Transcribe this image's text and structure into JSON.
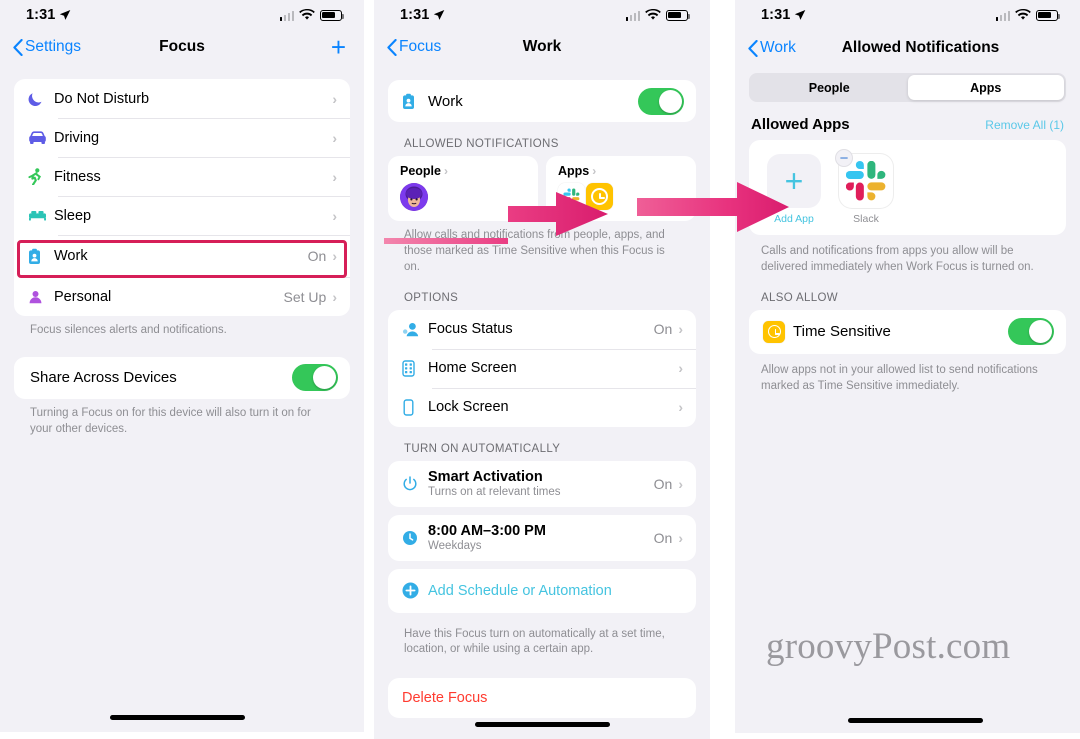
{
  "colors": {
    "accent_blue": "#0a84ff",
    "teal": "#45c4e0",
    "green_toggle": "#34c759",
    "highlight_pink": "#d61f58",
    "arrow_pink": "#e8337d",
    "destructive_red": "#ff3b30",
    "page_bg": "#f2f1f6"
  },
  "status_bar": {
    "time": "1:31",
    "location_icon": "location-arrow-icon",
    "wifi_icon": "wifi-icon",
    "battery_icon": "battery-icon",
    "cellular_icon": "cellular-bars-icon"
  },
  "panel1": {
    "nav": {
      "back_label": "Settings",
      "title": "Focus",
      "add_label": "+"
    },
    "focus_modes": [
      {
        "label": "Do Not Disturb",
        "icon": "moon-icon",
        "value": ""
      },
      {
        "label": "Driving",
        "icon": "car-icon",
        "value": ""
      },
      {
        "label": "Fitness",
        "icon": "runner-icon",
        "value": ""
      },
      {
        "label": "Sleep",
        "icon": "bed-icon",
        "value": ""
      },
      {
        "label": "Work",
        "icon": "badge-id-icon",
        "value": "On"
      },
      {
        "label": "Personal",
        "icon": "person-icon",
        "value": "Set Up"
      }
    ],
    "footnote": "Focus silences alerts and notifications.",
    "share": {
      "label": "Share Across Devices",
      "toggle_state": "on",
      "footnote": "Turning a Focus on for this device will also turn it on for your other devices."
    }
  },
  "panel2": {
    "nav": {
      "back_label": "Focus",
      "title": "Work"
    },
    "master": {
      "label": "Work",
      "icon": "badge-id-icon",
      "toggle_state": "on"
    },
    "allowed_section_header": "ALLOWED NOTIFICATIONS",
    "people_card": {
      "title": "People",
      "chevron": "›",
      "avatar": "person-avatar"
    },
    "apps_card": {
      "title": "Apps",
      "chevron": "›",
      "app_icons": [
        "slack-icon",
        "clock-icon"
      ]
    },
    "allowed_footnote": "Allow calls and notifications from people, apps, and those marked as Time Sensitive when this Focus is on.",
    "options_header": "OPTIONS",
    "options": [
      {
        "label": "Focus Status",
        "icon": "focus-status-icon",
        "value": "On"
      },
      {
        "label": "Home Screen",
        "icon": "home-screen-icon",
        "value": ""
      },
      {
        "label": "Lock Screen",
        "icon": "lock-screen-icon",
        "value": ""
      }
    ],
    "auto_header": "TURN ON AUTOMATICALLY",
    "automations": [
      {
        "label": "Smart Activation",
        "sub": "Turns on at relevant times",
        "icon": "power-icon",
        "value": "On"
      },
      {
        "label": "8:00 AM–3:00 PM",
        "sub": "Weekdays",
        "icon": "clock-filled-icon",
        "value": "On"
      }
    ],
    "add_schedule_label": "Add Schedule or Automation",
    "add_schedule_icon": "plus-circle-icon",
    "auto_footnote": "Have this Focus turn on automatically at a set time, location, or while using a certain app.",
    "delete_label": "Delete Focus"
  },
  "panel3": {
    "nav": {
      "back_label": "Work",
      "title": "Allowed Notifications"
    },
    "segments": [
      {
        "label": "People",
        "active": false
      },
      {
        "label": "Apps",
        "active": true
      }
    ],
    "allowed_apps_title": "Allowed Apps",
    "remove_all_label": "Remove All (1)",
    "apps": [
      {
        "label": "Add App",
        "icon": "plus-icon",
        "type": "add"
      },
      {
        "label": "Slack",
        "icon": "slack-icon",
        "type": "app",
        "badge": "minus-badge-icon"
      }
    ],
    "apps_footnote": "Calls and notifications from apps you allow will be delivered immediately when Work Focus is turned on.",
    "also_allow_header": "ALSO ALLOW",
    "time_sensitive": {
      "label": "Time Sensitive",
      "icon": "clock-icon",
      "toggle_state": "on"
    },
    "time_sensitive_footnote": "Allow apps not in your allowed list to send notifications marked as Time Sensitive immediately."
  },
  "watermark": "groovyPost.com"
}
